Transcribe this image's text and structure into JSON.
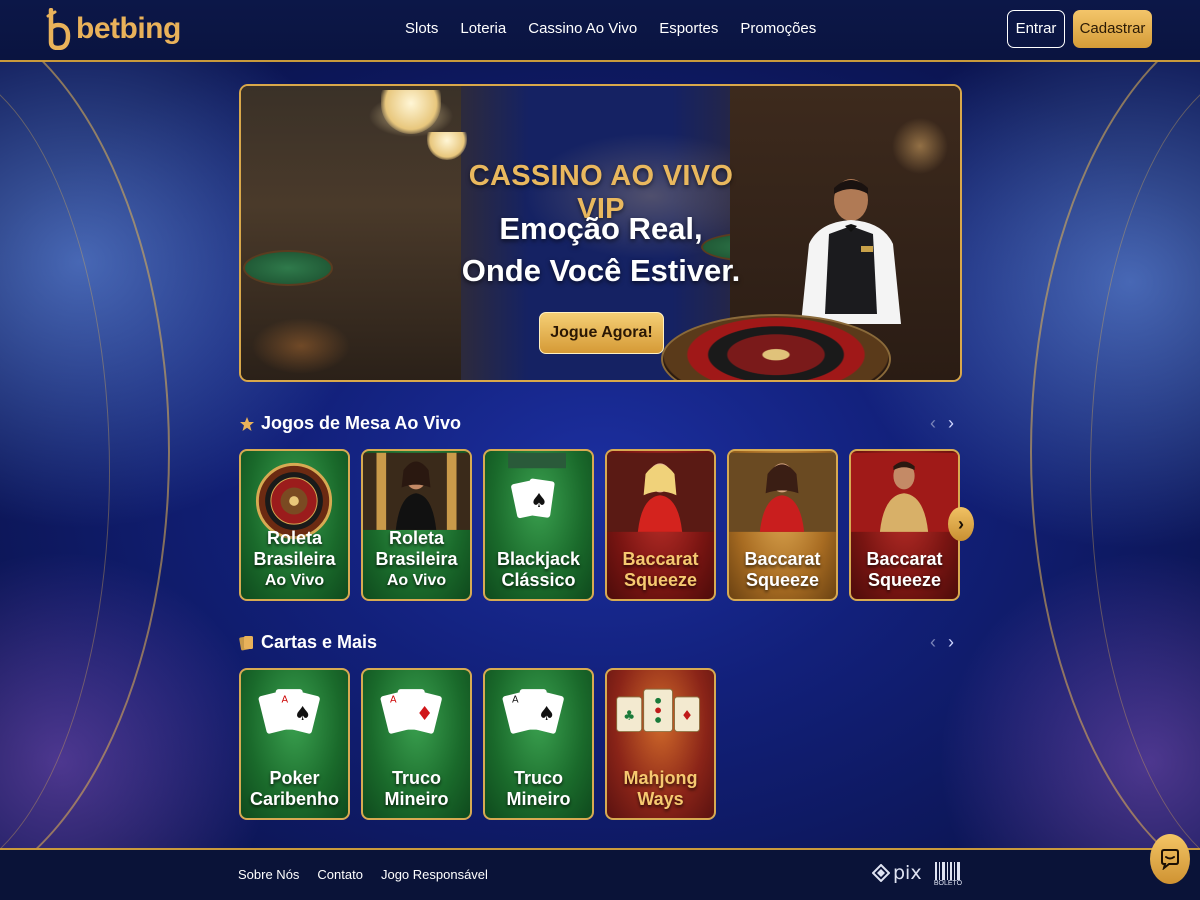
{
  "brand": {
    "name": "betbing"
  },
  "nav": {
    "items": [
      "Slots",
      "Loteria",
      "Cassino Ao Vivo",
      "Esportes",
      "Promoções"
    ]
  },
  "auth": {
    "login_label": "Entrar",
    "register_label": "Cadastrar"
  },
  "hero": {
    "kicker": "CASSINO AO VIVO VIP",
    "title_line1": "Emoção Real,",
    "title_line2": "Onde Você Estiver.",
    "cta_label": "Jogue Agora!"
  },
  "sections": [
    {
      "title": "Jogos de Mesa Ao Vivo",
      "icon": "star-icon",
      "cards": [
        {
          "line1": "Roleta",
          "line2": "Brasileira",
          "line3": "Ao Vivo",
          "theme": "green"
        },
        {
          "line1": "Roleta",
          "line2": "Brasileira",
          "line3": "Ao Vivo",
          "theme": "green"
        },
        {
          "line1": "Blackjack",
          "line2": "Clássico",
          "theme": "green"
        },
        {
          "line1": "Baccarat",
          "line2": "Squeeze",
          "theme": "red"
        },
        {
          "line1": "Baccarat",
          "line2": "Squeeze",
          "theme": "gold"
        },
        {
          "line1": "Baccarat",
          "line2": "Squeeze",
          "theme": "red"
        }
      ]
    },
    {
      "title": "Cartas e Mais",
      "icon": "cards-icon",
      "cards": [
        {
          "line1": "Poker",
          "line2": "Caribenho",
          "theme": "green"
        },
        {
          "line1": "Truco",
          "line2": "Mineiro",
          "theme": "green"
        },
        {
          "line1": "Truco",
          "line2": "Mineiro",
          "theme": "green"
        },
        {
          "line1": "Mahjong",
          "line2": "Ways",
          "theme": "mahjong"
        }
      ]
    }
  ],
  "footer": {
    "links": [
      "Sobre Nós",
      "Contato",
      "Jogo Responsável"
    ],
    "payments": {
      "pix": "pix",
      "boleto": "BOLETO"
    }
  },
  "colors": {
    "gold": "#d9a84a",
    "navy": "#0a1440",
    "accent_button": "#e9b25a"
  }
}
